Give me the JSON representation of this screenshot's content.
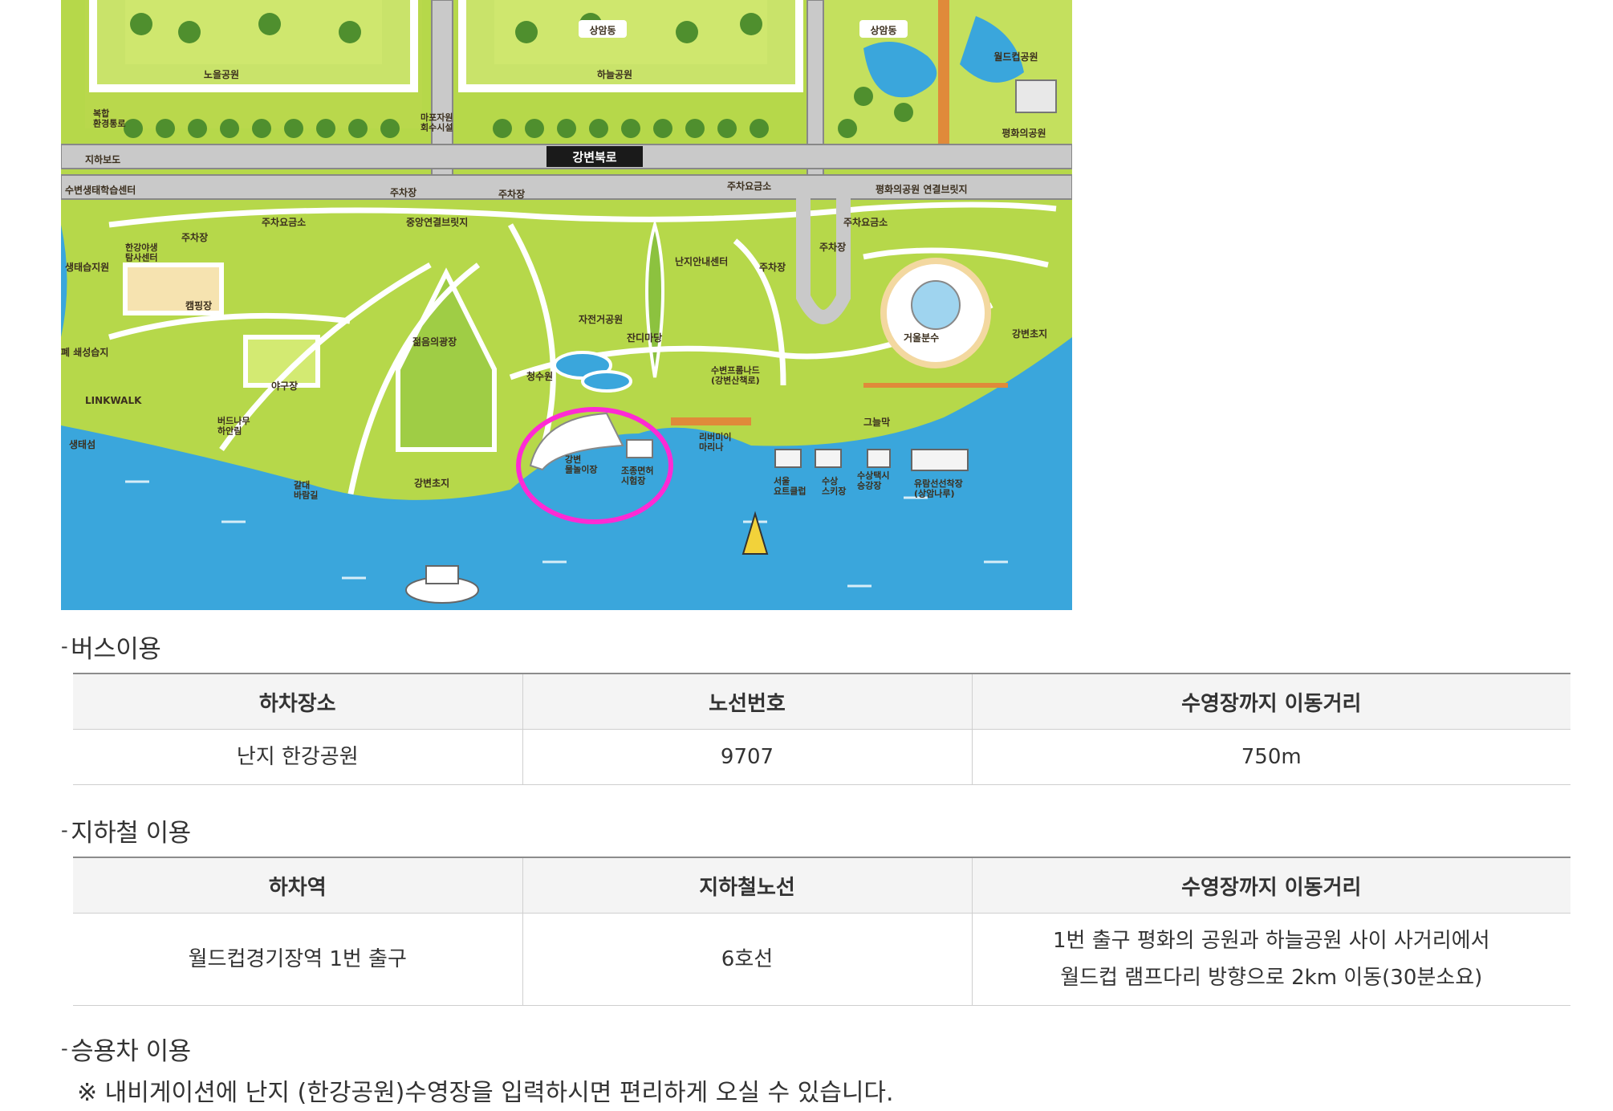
{
  "map": {
    "labels": {
      "noeul": "노을공원",
      "haneul": "하늘공원",
      "sangam1": "상암동",
      "sangam2": "상암동",
      "worldcup_park": "월드컵공원",
      "peace_park": "평화의공원",
      "road": "강변북로",
      "complex_bridge": "복합\n환경통로",
      "underpass": "지하보도",
      "mapo_facility": "마포자원\n회수시설",
      "eco_center": "수변생태학습센터",
      "parking1": "주차장",
      "parking2": "주차장",
      "parking3": "주차장",
      "parking4": "주차장",
      "parking5": "주차장",
      "toll1": "주차요금소",
      "toll2": "주차요금소",
      "toll3": "주차요금소",
      "central_bridge": "중앙연결브릿지",
      "peace_bridge": "평화의공원 연결브릿지",
      "wild_center": "한강야생\n탐사센터",
      "ecology_wetland": "생태습지원",
      "camping": "캠핑장",
      "bicycle": "자전거공원",
      "grass_plaza": "잔디마당",
      "info_center": "난지안내센터",
      "youth_plaza": "젊음의광장",
      "baseball": "야구장",
      "wetland_link": "LINKWALK",
      "trail": "폐 쇄성습지",
      "willow": "버드나무\n하안림",
      "ecology": "생태섬",
      "water_garden": "청수원",
      "swimming_pool": "강변\n물놀이장",
      "license": "조종면허\n시험장",
      "riverside_prom": "수변프롬나드\n(강변산책로)",
      "riverview": "리버미이\n마리나",
      "yacht": "서울\n요트클럽",
      "waterski": "수상\n스키장",
      "water_taxi": "수상택시\n승강장",
      "cruise": "유람선선착장\n(상암나루)",
      "shade": "그늘막",
      "fountain": "거울분수",
      "river_promenade": "강변초지",
      "riverside_meadow": "강변초지",
      "reed_road": "갈대\n바람길"
    }
  },
  "bus": {
    "title": "버스이용",
    "headers": [
      "하차장소",
      "노선번호",
      "수영장까지 이동거리"
    ],
    "rows": [
      [
        "난지 한강공원",
        "9707",
        "750m"
      ]
    ]
  },
  "subway": {
    "title": "지하철 이용",
    "headers": [
      "하차역",
      "지하철노선",
      "수영장까지 이동거리"
    ],
    "rows": [
      [
        "월드컵경기장역 1번 출구",
        "6호선",
        "1번 출구 평화의 공원과 하늘공원 사이 사거리에서\n월드컵 램프다리 방향으로 2km 이동(30분소요)"
      ]
    ]
  },
  "car": {
    "title": "승용차 이용",
    "note": "※ 내비게이션에 난지 (한강공원)수영장을 입력하시면 편리하게 오실 수 있습니다."
  },
  "colors": {
    "grass": "#b6d84a",
    "field": "#d9ec7a",
    "road": "#c9c9c9",
    "path": "#ffffff",
    "water": "#3aa6dc",
    "highlight": "#ff2ad4"
  }
}
